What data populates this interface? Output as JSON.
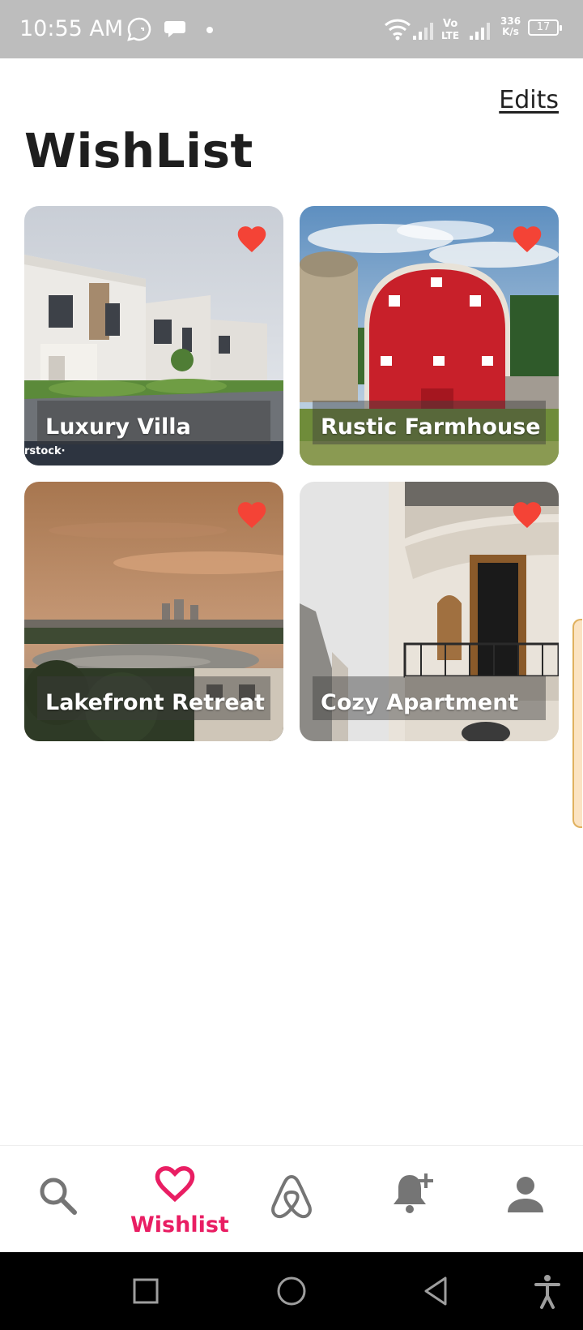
{
  "status_bar": {
    "time": "10:55 AM",
    "network_speed_value": "336",
    "network_speed_unit": "K/s",
    "battery_level": "17",
    "icons": [
      "whatsapp-icon",
      "chat-bubble-icon",
      "dot-icon",
      "wifi-icon",
      "signal-icon",
      "volte-icon",
      "signal-icon",
      "battery-icon"
    ]
  },
  "header": {
    "edits_label": "Edits",
    "title": "WishList"
  },
  "wishlist": {
    "items": [
      {
        "name": "Luxury Villa",
        "favorited": true
      },
      {
        "name": "Rustic Farmhouse",
        "favorited": true
      },
      {
        "name": "Lakefront Retreat",
        "favorited": true
      },
      {
        "name": "Cozy Apartment",
        "favorited": true
      }
    ]
  },
  "bottom_nav": {
    "items": [
      {
        "icon": "search-icon",
        "label": ""
      },
      {
        "icon": "heart-icon",
        "label": "Wishlist",
        "active": true
      },
      {
        "icon": "airbnb-logo-icon",
        "label": ""
      },
      {
        "icon": "bell-plus-icon",
        "label": ""
      },
      {
        "icon": "profile-icon",
        "label": ""
      }
    ]
  },
  "system_nav": {
    "icons": [
      "recent-apps-icon",
      "home-icon",
      "back-icon",
      "accessibility-icon"
    ]
  },
  "colors": {
    "accent": "#e91e63",
    "heart": "#f44336",
    "status_bar": "#bdbdbd",
    "icon_gray": "#757575"
  }
}
